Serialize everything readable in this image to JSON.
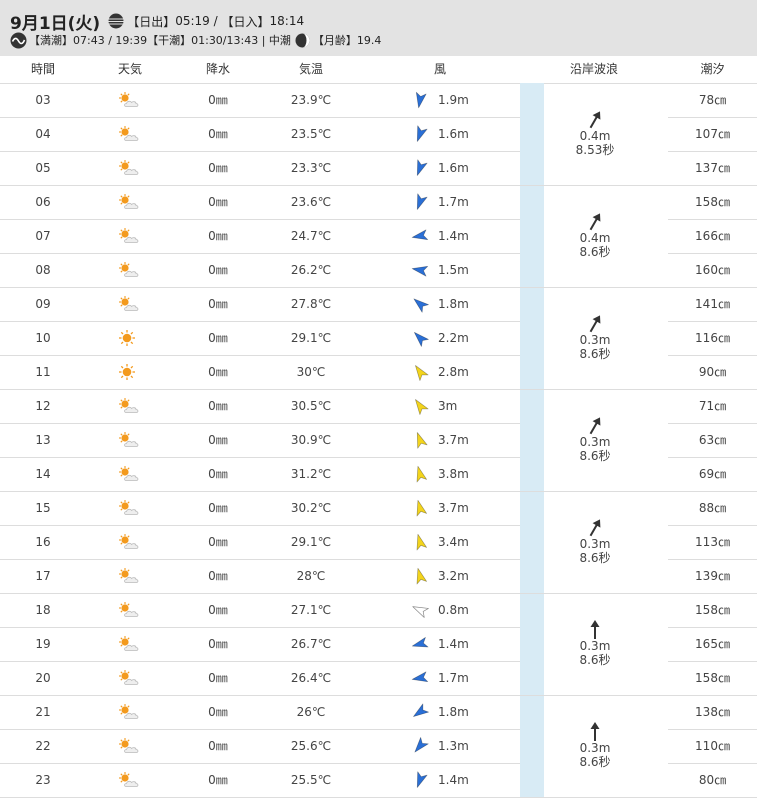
{
  "header": {
    "date": "9月1日(火)",
    "sunrise_label": "【日出】",
    "sunrise": "05:19",
    "sep": " / ",
    "sunset_label": "【日入】",
    "sunset": "18:14",
    "high_tide_label": "【満潮】",
    "high_tide": "07:43 / 19:39",
    "low_tide_label": "【干潮】",
    "low_tide": "01:30/13:43",
    "tide_type_sep": " | ",
    "tide_type": "中潮",
    "moon_age_label": "【月齢】",
    "moon_age": "19.4"
  },
  "columns": {
    "time": "時間",
    "weather": "天気",
    "precip": "降水",
    "temp": "気温",
    "wind": "風",
    "wave": "沿岸波浪",
    "tide": "潮汐"
  },
  "rows": [
    {
      "hour": "03",
      "weather": "sunny-cloudy-icon",
      "precip": "0㎜",
      "temp": "23.9℃",
      "wind_dir_deg": 190,
      "wind_color": "#2a6fd6",
      "wind": "1.9m",
      "tide": "78㎝"
    },
    {
      "hour": "04",
      "weather": "sunny-cloudy-icon",
      "precip": "0㎜",
      "temp": "23.5℃",
      "wind_dir_deg": 200,
      "wind_color": "#2a6fd6",
      "wind": "1.6m",
      "tide": "107㎝"
    },
    {
      "hour": "05",
      "weather": "sunny-cloudy-icon",
      "precip": "0㎜",
      "temp": "23.3℃",
      "wind_dir_deg": 200,
      "wind_color": "#2a6fd6",
      "wind": "1.6m",
      "tide": "137㎝"
    },
    {
      "hour": "06",
      "weather": "sunny-cloudy-icon",
      "precip": "0㎜",
      "temp": "23.6℃",
      "wind_dir_deg": 200,
      "wind_color": "#2a6fd6",
      "wind": "1.7m",
      "tide": "158㎝"
    },
    {
      "hour": "07",
      "weather": "sunny-cloudy-icon",
      "precip": "0㎜",
      "temp": "24.7℃",
      "wind_dir_deg": 260,
      "wind_color": "#2a6fd6",
      "wind": "1.4m",
      "tide": "166㎝"
    },
    {
      "hour": "08",
      "weather": "sunny-cloudy-icon",
      "precip": "0㎜",
      "temp": "26.2℃",
      "wind_dir_deg": 280,
      "wind_color": "#2a6fd6",
      "wind": "1.5m",
      "tide": "160㎝"
    },
    {
      "hour": "09",
      "weather": "sunny-cloudy-icon",
      "precip": "0㎜",
      "temp": "27.8℃",
      "wind_dir_deg": 310,
      "wind_color": "#2a6fd6",
      "wind": "1.8m",
      "tide": "141㎝"
    },
    {
      "hour": "10",
      "weather": "sunny-icon",
      "precip": "0㎜",
      "temp": "29.1℃",
      "wind_dir_deg": 315,
      "wind_color": "#2a6fd6",
      "wind": "2.2m",
      "tide": "116㎝"
    },
    {
      "hour": "11",
      "weather": "sunny-icon",
      "precip": "0㎜",
      "temp": "30℃",
      "wind_dir_deg": 325,
      "wind_color": "#f3d41c",
      "wind": "2.8m",
      "tide": "90㎝"
    },
    {
      "hour": "12",
      "weather": "sunny-cloudy-icon",
      "precip": "0㎜",
      "temp": "30.5℃",
      "wind_dir_deg": 325,
      "wind_color": "#f3d41c",
      "wind": "3m",
      "tide": "71㎝"
    },
    {
      "hour": "13",
      "weather": "sunny-cloudy-icon",
      "precip": "0㎜",
      "temp": "30.9℃",
      "wind_dir_deg": 340,
      "wind_color": "#f3d41c",
      "wind": "3.7m",
      "tide": "63㎝"
    },
    {
      "hour": "14",
      "weather": "sunny-cloudy-icon",
      "precip": "0㎜",
      "temp": "31.2℃",
      "wind_dir_deg": 345,
      "wind_color": "#f3d41c",
      "wind": "3.8m",
      "tide": "69㎝"
    },
    {
      "hour": "15",
      "weather": "sunny-cloudy-icon",
      "precip": "0㎜",
      "temp": "30.2℃",
      "wind_dir_deg": 345,
      "wind_color": "#f3d41c",
      "wind": "3.7m",
      "tide": "88㎝"
    },
    {
      "hour": "16",
      "weather": "sunny-cloudy-icon",
      "precip": "0㎜",
      "temp": "29.1℃",
      "wind_dir_deg": 345,
      "wind_color": "#f3d41c",
      "wind": "3.4m",
      "tide": "113㎝"
    },
    {
      "hour": "17",
      "weather": "sunny-cloudy-icon",
      "precip": "0㎜",
      "temp": "28℃",
      "wind_dir_deg": 345,
      "wind_color": "#f3d41c",
      "wind": "3.2m",
      "tide": "139㎝"
    },
    {
      "hour": "18",
      "weather": "sunny-cloudy-icon",
      "precip": "0㎜",
      "temp": "27.1℃",
      "wind_dir_deg": 295,
      "wind_color": "#ffffff",
      "wind": "0.8m",
      "tide": "158㎝"
    },
    {
      "hour": "19",
      "weather": "sunny-cloudy-icon",
      "precip": "0㎜",
      "temp": "26.7℃",
      "wind_dir_deg": 255,
      "wind_color": "#2a6fd6",
      "wind": "1.4m",
      "tide": "165㎝"
    },
    {
      "hour": "20",
      "weather": "sunny-cloudy-icon",
      "precip": "0㎜",
      "temp": "26.4℃",
      "wind_dir_deg": 260,
      "wind_color": "#2a6fd6",
      "wind": "1.7m",
      "tide": "158㎝"
    },
    {
      "hour": "21",
      "weather": "sunny-cloudy-icon",
      "precip": "0㎜",
      "temp": "26℃",
      "wind_dir_deg": 235,
      "wind_color": "#2a6fd6",
      "wind": "1.8m",
      "tide": "138㎝"
    },
    {
      "hour": "22",
      "weather": "sunny-cloudy-icon",
      "precip": "0㎜",
      "temp": "25.6℃",
      "wind_dir_deg": 220,
      "wind_color": "#2a6fd6",
      "wind": "1.3m",
      "tide": "110㎝"
    },
    {
      "hour": "23",
      "weather": "sunny-cloudy-icon",
      "precip": "0㎜",
      "temp": "25.5℃",
      "wind_dir_deg": 200,
      "wind_color": "#2a6fd6",
      "wind": "1.4m",
      "tide": "80㎝"
    }
  ],
  "waves": [
    {
      "dir_deg": 30,
      "height": "0.4m",
      "period": "8.53秒"
    },
    {
      "dir_deg": 30,
      "height": "0.4m",
      "period": "8.6秒"
    },
    {
      "dir_deg": 30,
      "height": "0.3m",
      "period": "8.6秒"
    },
    {
      "dir_deg": 30,
      "height": "0.3m",
      "period": "8.6秒"
    },
    {
      "dir_deg": 30,
      "height": "0.3m",
      "period": "8.6秒"
    },
    {
      "dir_deg": 0,
      "height": "0.3m",
      "period": "8.6秒"
    },
    {
      "dir_deg": 0,
      "height": "0.3m",
      "period": "8.6秒"
    }
  ]
}
